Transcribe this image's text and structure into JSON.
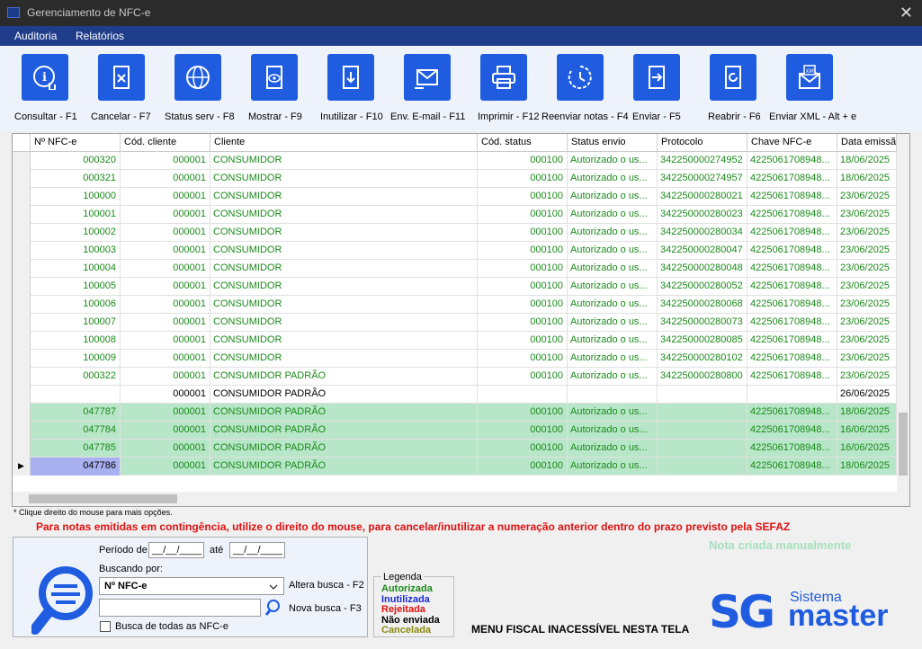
{
  "window": {
    "title": "Gerenciamento de NFC-e",
    "close_glyph": "✕"
  },
  "menu": {
    "items": [
      "Auditoria",
      "Relatórios"
    ]
  },
  "toolbar": {
    "buttons": [
      {
        "label": "Consultar - F1",
        "icon": "info-touch-icon"
      },
      {
        "label": "Cancelar - F7",
        "icon": "cancel-document-icon"
      },
      {
        "label": "Status serv - F8",
        "icon": "globe-icon"
      },
      {
        "label": "Mostrar - F9",
        "icon": "view-document-icon"
      },
      {
        "label": "Inutilizar - F10",
        "icon": "download-document-icon"
      },
      {
        "label": "Env. E-mail - F11",
        "icon": "send-email-icon"
      },
      {
        "label": "Imprimir - F12",
        "icon": "printer-icon"
      },
      {
        "label": "Reenviar notas - F4",
        "icon": "resend-icon"
      },
      {
        "label": "Enviar - F5",
        "icon": "send-document-icon"
      },
      {
        "label": "Reabrir - F6",
        "icon": "reopen-document-icon"
      },
      {
        "label": "Enviar XML - Alt + e",
        "icon": "xml-email-icon"
      }
    ]
  },
  "grid": {
    "columns": [
      "Nº NFC-e",
      "Cód. cliente",
      "Cliente",
      "Cód. status",
      "Status envio",
      "Protocolo",
      "Chave NFC-e",
      "Data emissã"
    ],
    "rows": [
      {
        "nfce": "000320",
        "cod_cliente": "000001",
        "cliente": "CONSUMIDOR",
        "cod_status": "000100",
        "status": "Autorizado o us...",
        "protocolo": "342250000274952",
        "chave": "4225061708948...",
        "data": "18/06/2025",
        "style": "auth"
      },
      {
        "nfce": "000321",
        "cod_cliente": "000001",
        "cliente": "CONSUMIDOR",
        "cod_status": "000100",
        "status": "Autorizado o us...",
        "protocolo": "342250000274957",
        "chave": "4225061708948...",
        "data": "18/06/2025",
        "style": "auth"
      },
      {
        "nfce": "100000",
        "cod_cliente": "000001",
        "cliente": "CONSUMIDOR",
        "cod_status": "000100",
        "status": "Autorizado o us...",
        "protocolo": "342250000280021",
        "chave": "4225061708948...",
        "data": "23/06/2025",
        "style": "auth"
      },
      {
        "nfce": "100001",
        "cod_cliente": "000001",
        "cliente": "CONSUMIDOR",
        "cod_status": "000100",
        "status": "Autorizado o us...",
        "protocolo": "342250000280023",
        "chave": "4225061708948...",
        "data": "23/06/2025",
        "style": "auth"
      },
      {
        "nfce": "100002",
        "cod_cliente": "000001",
        "cliente": "CONSUMIDOR",
        "cod_status": "000100",
        "status": "Autorizado o us...",
        "protocolo": "342250000280034",
        "chave": "4225061708948...",
        "data": "23/06/2025",
        "style": "auth"
      },
      {
        "nfce": "100003",
        "cod_cliente": "000001",
        "cliente": "CONSUMIDOR",
        "cod_status": "000100",
        "status": "Autorizado o us...",
        "protocolo": "342250000280047",
        "chave": "4225061708948...",
        "data": "23/06/2025",
        "style": "auth"
      },
      {
        "nfce": "100004",
        "cod_cliente": "000001",
        "cliente": "CONSUMIDOR",
        "cod_status": "000100",
        "status": "Autorizado o us...",
        "protocolo": "342250000280048",
        "chave": "4225061708948...",
        "data": "23/06/2025",
        "style": "auth"
      },
      {
        "nfce": "100005",
        "cod_cliente": "000001",
        "cliente": "CONSUMIDOR",
        "cod_status": "000100",
        "status": "Autorizado o us...",
        "protocolo": "342250000280052",
        "chave": "4225061708948...",
        "data": "23/06/2025",
        "style": "auth"
      },
      {
        "nfce": "100006",
        "cod_cliente": "000001",
        "cliente": "CONSUMIDOR",
        "cod_status": "000100",
        "status": "Autorizado o us...",
        "protocolo": "342250000280068",
        "chave": "4225061708948...",
        "data": "23/06/2025",
        "style": "auth"
      },
      {
        "nfce": "100007",
        "cod_cliente": "000001",
        "cliente": "CONSUMIDOR",
        "cod_status": "000100",
        "status": "Autorizado o us...",
        "protocolo": "342250000280073",
        "chave": "4225061708948...",
        "data": "23/06/2025",
        "style": "auth"
      },
      {
        "nfce": "100008",
        "cod_cliente": "000001",
        "cliente": "CONSUMIDOR",
        "cod_status": "000100",
        "status": "Autorizado o us...",
        "protocolo": "342250000280085",
        "chave": "4225061708948...",
        "data": "23/06/2025",
        "style": "auth"
      },
      {
        "nfce": "100009",
        "cod_cliente": "000001",
        "cliente": "CONSUMIDOR",
        "cod_status": "000100",
        "status": "Autorizado o us...",
        "protocolo": "342250000280102",
        "chave": "4225061708948...",
        "data": "23/06/2025",
        "style": "auth"
      },
      {
        "nfce": "000322",
        "cod_cliente": "000001",
        "cliente": "CONSUMIDOR PADRÃO",
        "cod_status": "000100",
        "status": "Autorizado o us...",
        "protocolo": "342250000280800",
        "chave": "4225061708948...",
        "data": "23/06/2025",
        "style": "auth"
      },
      {
        "nfce": "",
        "cod_cliente": "000001",
        "cliente": "CONSUMIDOR PADRÃO",
        "cod_status": "",
        "status": "",
        "protocolo": "",
        "chave": "",
        "data": "26/06/2025",
        "style": "plain"
      },
      {
        "nfce": "047787",
        "cod_cliente": "000001",
        "cliente": "CONSUMIDOR PADRÃO",
        "cod_status": "000100",
        "status": "Autorizado o us...",
        "protocolo": "",
        "chave": "4225061708948...",
        "data": "18/06/2025",
        "style": "manual"
      },
      {
        "nfce": "047784",
        "cod_cliente": "000001",
        "cliente": "CONSUMIDOR PADRÃO",
        "cod_status": "000100",
        "status": "Autorizado o us...",
        "protocolo": "",
        "chave": "4225061708948...",
        "data": "16/06/2025",
        "style": "manual"
      },
      {
        "nfce": "047785",
        "cod_cliente": "000001",
        "cliente": "CONSUMIDOR PADRÃO",
        "cod_status": "000100",
        "status": "Autorizado o us...",
        "protocolo": "",
        "chave": "4225061708948...",
        "data": "16/06/2025",
        "style": "manual"
      },
      {
        "nfce": "047786",
        "cod_cliente": "000001",
        "cliente": "CONSUMIDOR PADRÃO",
        "cod_status": "000100",
        "status": "Autorizado o us...",
        "protocolo": "",
        "chave": "4225061708948...",
        "data": "18/06/2025",
        "style": "manual",
        "selected": true
      }
    ],
    "row_indicator": "▶",
    "colors": {
      "auth_text": "#1a8a1a",
      "manual_bg": "#b8e6c8",
      "selected_cell_bg": "#a8b0f0"
    }
  },
  "hints": {
    "right_click": "* Clique direito do mouse para mais opções.",
    "contingency": "Para notas emitidas em contingência, utilize o direito do mouse, para cancelar/inutilizar a numeração anterior dentro do prazo previsto pela SEFAZ",
    "manual_note": "Nota criada manualmente"
  },
  "search": {
    "period_label": "Período de",
    "date_from": "__/__/____",
    "until_label": "até",
    "date_to": "__/__/____",
    "searching_by_label": "Buscando por:",
    "selected_field": "Nº NFC-e",
    "change_search": "Altera busca - F2",
    "new_search": "Nova busca - F3",
    "search_value": "",
    "all_nfce_label": "Busca de todas as NFC-e"
  },
  "legend": {
    "title": "Legenda",
    "items": [
      {
        "label": "Autorizada",
        "color": "#1a8a1a"
      },
      {
        "label": "Inutilizada",
        "color": "#1a2ad0"
      },
      {
        "label": "Rejeitada",
        "color": "#e01010"
      },
      {
        "label": "Não enviada",
        "color": "#000000"
      },
      {
        "label": "Cancelada",
        "color": "#8a8a10"
      }
    ]
  },
  "footer": {
    "fiscal_menu": "MENU FISCAL INACESSÍVEL NESTA TELA"
  },
  "brand": {
    "mark": "SG",
    "line1": "Sistema",
    "line2": "master",
    "color": "#1f5ce0"
  }
}
